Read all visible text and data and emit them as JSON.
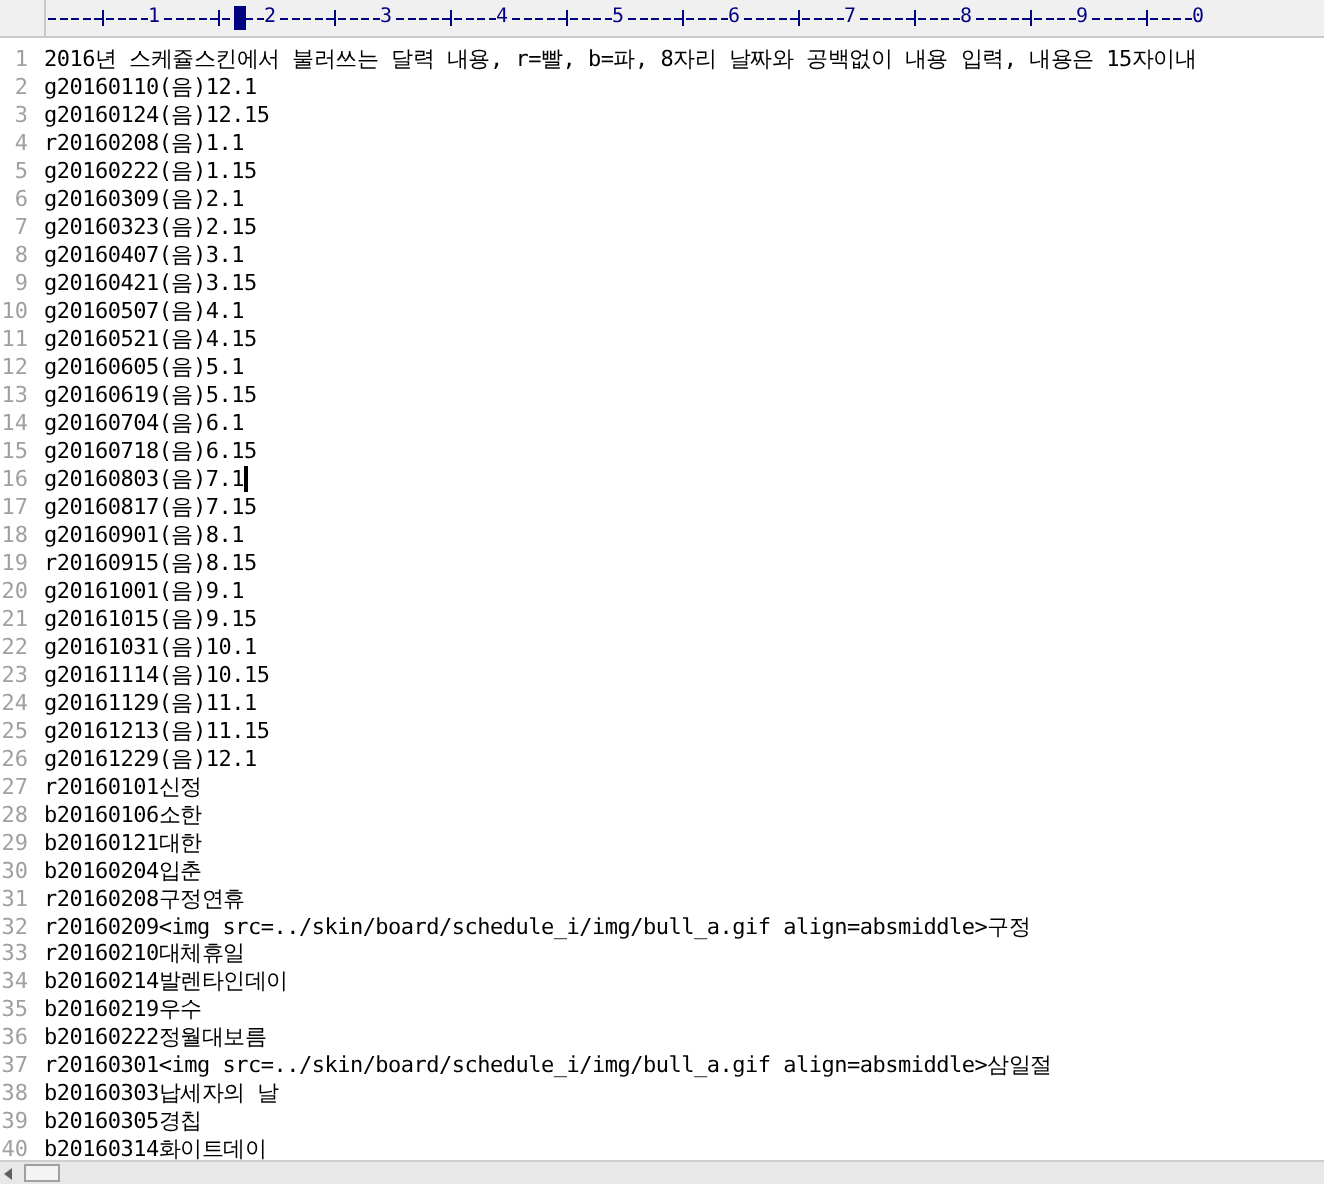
{
  "ruler": {
    "labels": [
      "1",
      "2",
      "3",
      "4",
      "5",
      "6",
      "7",
      "8",
      "9",
      "0"
    ]
  },
  "lines": [
    {
      "number": "1",
      "text": "2016년 스케쥴스킨에서 불러쓰는 달력 내용, r=빨, b=파, 8자리 날짜와 공백없이 내용 입력, 내용은 15자이내",
      "caret": false
    },
    {
      "number": "2",
      "text": "g20160110(음)12.1",
      "caret": false
    },
    {
      "number": "3",
      "text": "g20160124(음)12.15",
      "caret": false
    },
    {
      "number": "4",
      "text": "r20160208(음)1.1",
      "caret": false
    },
    {
      "number": "5",
      "text": "g20160222(음)1.15",
      "caret": false
    },
    {
      "number": "6",
      "text": "g20160309(음)2.1",
      "caret": false
    },
    {
      "number": "7",
      "text": "g20160323(음)2.15",
      "caret": false
    },
    {
      "number": "8",
      "text": "g20160407(음)3.1",
      "caret": false
    },
    {
      "number": "9",
      "text": "g20160421(음)3.15",
      "caret": false
    },
    {
      "number": "10",
      "text": "g20160507(음)4.1",
      "caret": false
    },
    {
      "number": "11",
      "text": "g20160521(음)4.15",
      "caret": false
    },
    {
      "number": "12",
      "text": "g20160605(음)5.1",
      "caret": false
    },
    {
      "number": "13",
      "text": "g20160619(음)5.15",
      "caret": false
    },
    {
      "number": "14",
      "text": "g20160704(음)6.1",
      "caret": false
    },
    {
      "number": "15",
      "text": "g20160718(음)6.15",
      "caret": false
    },
    {
      "number": "16",
      "text": "g20160803(음)7.1",
      "caret": true
    },
    {
      "number": "17",
      "text": "g20160817(음)7.15",
      "caret": false
    },
    {
      "number": "18",
      "text": "g20160901(음)8.1",
      "caret": false
    },
    {
      "number": "19",
      "text": "r20160915(음)8.15",
      "caret": false
    },
    {
      "number": "20",
      "text": "g20161001(음)9.1",
      "caret": false
    },
    {
      "number": "21",
      "text": "g20161015(음)9.15",
      "caret": false
    },
    {
      "number": "22",
      "text": "g20161031(음)10.1",
      "caret": false
    },
    {
      "number": "23",
      "text": "g20161114(음)10.15",
      "caret": false
    },
    {
      "number": "24",
      "text": "g20161129(음)11.1",
      "caret": false
    },
    {
      "number": "25",
      "text": "g20161213(음)11.15",
      "caret": false
    },
    {
      "number": "26",
      "text": "g20161229(음)12.1",
      "caret": false
    },
    {
      "number": "27",
      "text": "r20160101신정",
      "caret": false
    },
    {
      "number": "28",
      "text": "b20160106소한",
      "caret": false
    },
    {
      "number": "29",
      "text": "b20160121대한",
      "caret": false
    },
    {
      "number": "30",
      "text": "b20160204입춘",
      "caret": false
    },
    {
      "number": "31",
      "text": "r20160208구정연휴",
      "caret": false
    },
    {
      "number": "32",
      "text": "r20160209<img src=../skin/board/schedule_i/img/bull_a.gif align=absmiddle>구정",
      "caret": false
    },
    {
      "number": "33",
      "text": "r20160210대체휴일",
      "caret": false
    },
    {
      "number": "34",
      "text": "b20160214발렌타인데이",
      "caret": false
    },
    {
      "number": "35",
      "text": "b20160219우수",
      "caret": false
    },
    {
      "number": "36",
      "text": "b20160222정월대보름",
      "caret": false
    },
    {
      "number": "37",
      "text": "r20160301<img src=../skin/board/schedule_i/img/bull_a.gif align=absmiddle>삼일절",
      "caret": false
    },
    {
      "number": "38",
      "text": "b20160303납세자의 날",
      "caret": false
    },
    {
      "number": "39",
      "text": "b20160305경칩",
      "caret": false
    },
    {
      "number": "40",
      "text": "b20160314화이트데이",
      "caret": false
    }
  ]
}
